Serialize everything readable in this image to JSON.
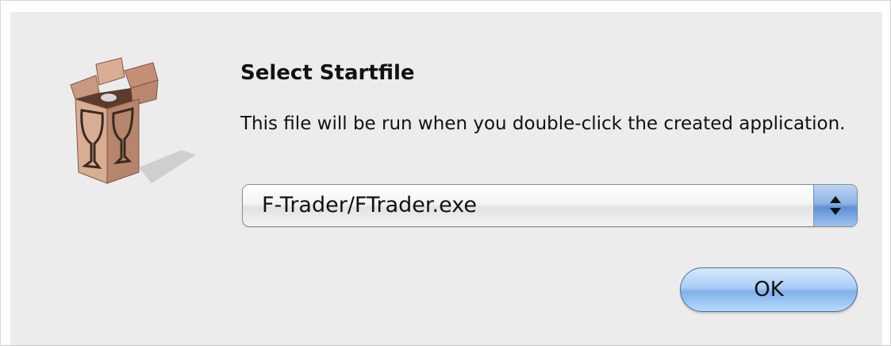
{
  "dialog": {
    "title": "Select Startfile",
    "message": "This file will be run when you double-click the created application.",
    "icon": "wine-box-icon"
  },
  "startfile_select": {
    "selected": "F-Trader/FTrader.exe",
    "arrows_icon": "popup-arrows-icon"
  },
  "buttons": {
    "ok_label": "OK"
  },
  "colors": {
    "dialog_bg": "#ececec",
    "accent_blue": "#8fb4e6",
    "text": "#111111"
  }
}
